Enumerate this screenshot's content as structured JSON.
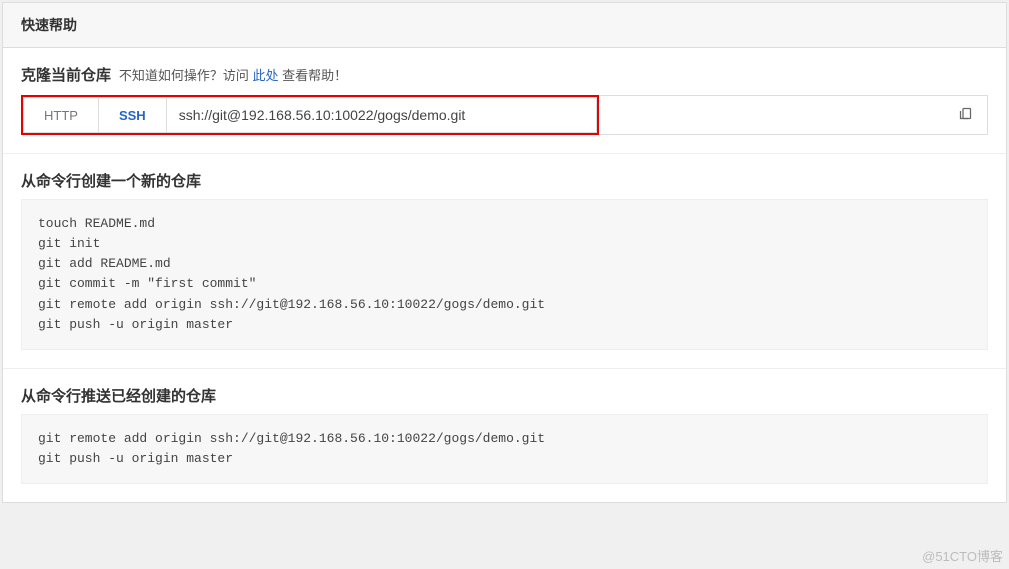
{
  "panel": {
    "header_title": "快速帮助"
  },
  "clone": {
    "title": "克隆当前仓库",
    "subtitle_prefix": "不知道如何操作？访问 ",
    "subtitle_link": "此处",
    "subtitle_suffix": " 查看帮助！",
    "tab_http": "HTTP",
    "tab_ssh": "SSH",
    "url": "ssh://git@192.168.56.10:10022/gogs/demo.git"
  },
  "section_create": {
    "title": "从命令行创建一个新的仓库",
    "code": "touch README.md\ngit init\ngit add README.md\ngit commit -m \"first commit\"\ngit remote add origin ssh://git@192.168.56.10:10022/gogs/demo.git\ngit push -u origin master"
  },
  "section_push": {
    "title": "从命令行推送已经创建的仓库",
    "code": "git remote add origin ssh://git@192.168.56.10:10022/gogs/demo.git\ngit push -u origin master"
  },
  "watermark": "@51CTO博客"
}
